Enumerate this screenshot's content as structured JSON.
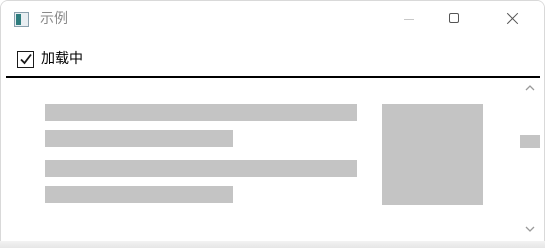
{
  "window": {
    "title": "示例",
    "icon": "app-window-icon"
  },
  "titlebar_buttons": {
    "minimize_icon": "minimize-icon",
    "maximize_icon": "maximize-icon",
    "close_icon": "close-icon"
  },
  "toolbar": {
    "checkbox_label": "加载中",
    "checkbox_checked": true
  },
  "content": {
    "skeleton_line_count": 4,
    "skeleton_image": true
  },
  "scrollbar": {
    "up_icon": "chevron-up-icon",
    "down_icon": "chevron-down-icon"
  },
  "colors": {
    "skeleton": "#c4c4c4",
    "divider": "#000000",
    "title_text": "#8a8a8a"
  }
}
